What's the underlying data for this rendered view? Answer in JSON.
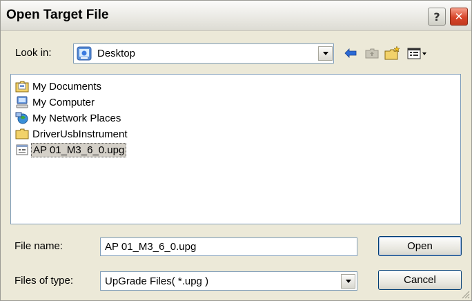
{
  "window": {
    "title": "Open Target File"
  },
  "titlebar_buttons": {
    "help": "?",
    "close": "✕"
  },
  "lookin": {
    "label": "Look in:",
    "value": "Desktop",
    "icon": "desktop-icon"
  },
  "toolbar": {
    "icons": [
      "back-arrow-icon",
      "up-folder-icon",
      "new-folder-icon",
      "view-menu-icon"
    ]
  },
  "files": [
    {
      "label": "My Documents",
      "icon": "my-documents-icon",
      "selected": false
    },
    {
      "label": "My Computer",
      "icon": "my-computer-icon",
      "selected": false
    },
    {
      "label": "My Network Places",
      "icon": "network-places-icon",
      "selected": false
    },
    {
      "label": "DriverUsbInstrument",
      "icon": "folder-icon",
      "selected": false
    },
    {
      "label": "AP 01_M3_6_0.upg",
      "icon": "upg-file-icon",
      "selected": true
    }
  ],
  "filename": {
    "label": "File name:",
    "value": "AP 01_M3_6_0.upg"
  },
  "filetype": {
    "label": "Files of type:",
    "value": "UpGrade Files( *.upg )"
  },
  "buttons": {
    "open": "Open",
    "cancel": "Cancel"
  }
}
